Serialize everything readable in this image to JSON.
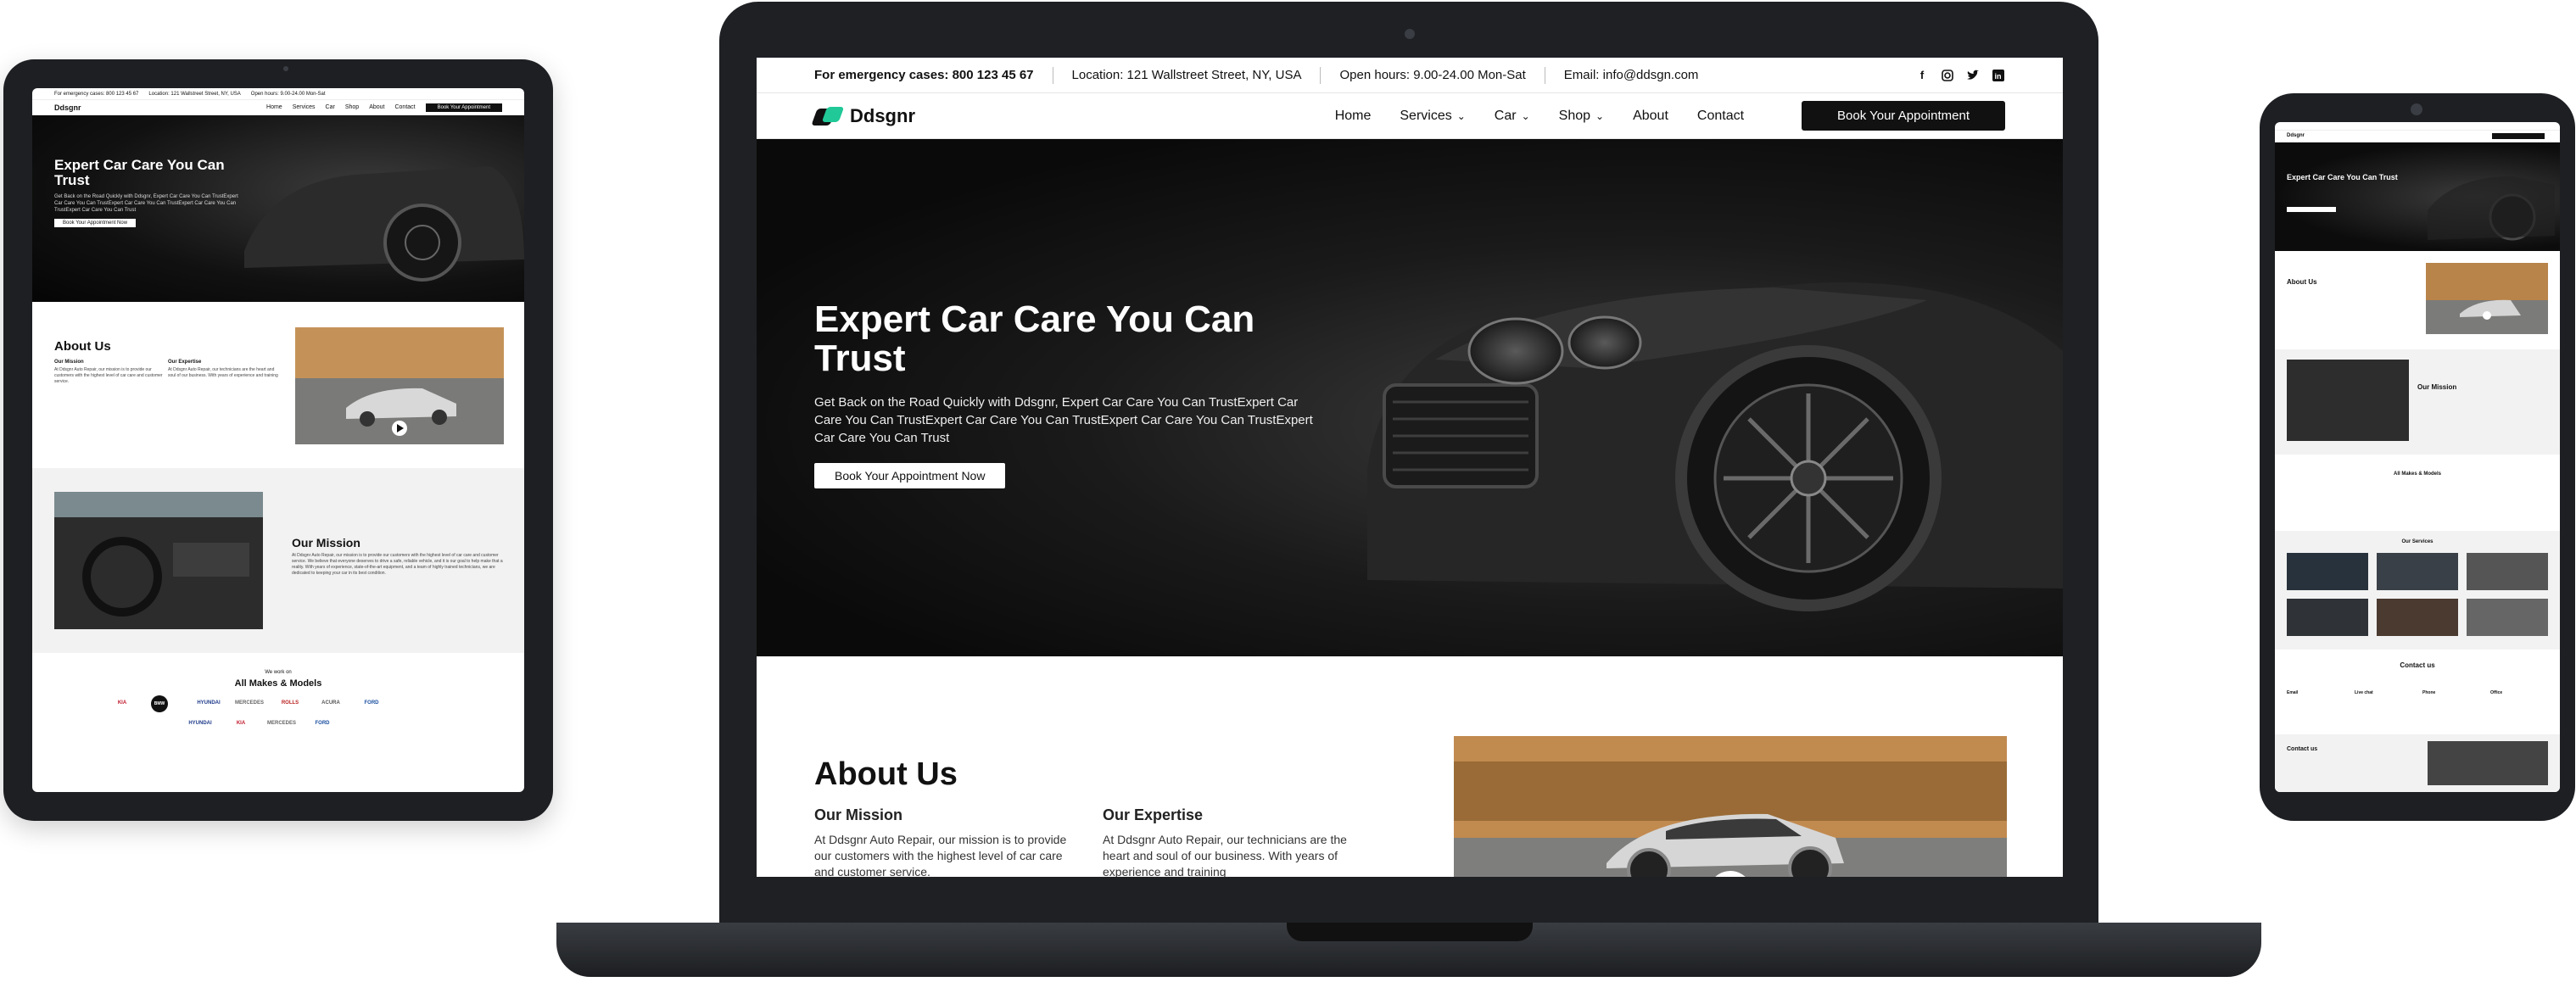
{
  "site": {
    "brand": "Ddsgnr",
    "topbar": {
      "emergency": "For emergency cases: 800 123 45 67",
      "location": "Location: 121 Wallstreet Street, NY, USA",
      "hours": "Open hours: 9.00-24.00 Mon-Sat",
      "email": "Email: info@ddsgn.com"
    },
    "nav": {
      "items": [
        "Home",
        "Services",
        "Car",
        "Shop",
        "About",
        "Contact"
      ],
      "cta": "Book Your Appointment"
    },
    "hero": {
      "title": "Expert Car Care You Can Trust",
      "text": "Get Back on the Road Quickly with Ddsgnr, Expert Car Care You Can TrustExpert Car Care You Can TrustExpert Car Care You Can TrustExpert Car Care You Can TrustExpert Car Care You Can Trust",
      "cta": "Book Your Appointment Now"
    },
    "about": {
      "title": "About Us",
      "mission_title": "Our Mission",
      "mission_text": "At Ddsgnr Auto Repair, our mission is to provide our customers with the highest level of car care and customer service.",
      "expertise_title": "Our Expertise",
      "expertise_text": "At Ddsgnr Auto Repair, our technicians are the heart and soul of our business. With years of experience and training"
    },
    "mission": {
      "title": "Our Mission",
      "text": "At Ddsgnr Auto Repair, our mission is to provide our customers with the highest level of car care and customer service. We believe that everyone deserves to drive a safe, reliable vehicle, and it is our goal to help make that a reality. With years of experience, state-of-the-art equipment, and a team of highly trained technicians, we are dedicated to keeping your car in its best condition."
    },
    "makes": {
      "kicker": "We work on",
      "title": "All Makes & Models",
      "brands": [
        "KIA",
        "BMW",
        "HYUNDAI",
        "MERCEDES",
        "ROLLS",
        "ACURA",
        "FORD",
        "HYUNDAI",
        "KIA",
        "MERCEDES",
        "FORD"
      ]
    },
    "phone": {
      "services_title": "Our Services",
      "contact_title": "Contact us",
      "contact_items": [
        "Email",
        "Live chat",
        "Phone",
        "Office"
      ],
      "form_title": "Contact us"
    }
  },
  "colors": {
    "accent": "#20c997",
    "dark": "#111111"
  },
  "icons": [
    "facebook-icon",
    "instagram-icon",
    "twitter-icon",
    "linkedin-icon",
    "chevron-down-icon",
    "play-icon"
  ]
}
